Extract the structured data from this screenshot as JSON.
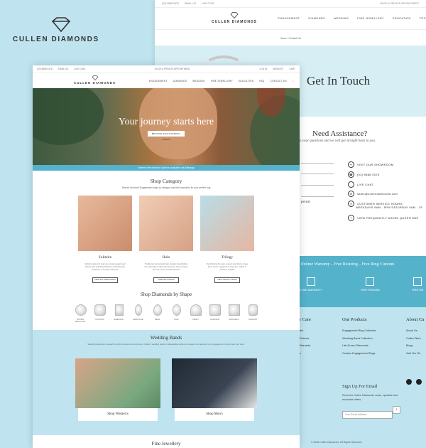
{
  "brand": {
    "name": "CULLEN DIAMONDS"
  },
  "contact_page": {
    "topbar": {
      "phone": "(03) 9888 5378",
      "email": "EMAIL US",
      "chat": "LIVE CHAT",
      "right": "BOOK A PRIVATE APPOINTMENT"
    },
    "nav": [
      "ENGAGEMENT",
      "DIAMONDS",
      "WEDDING",
      "FINE JEWELLERY",
      "EDUCATION",
      "TOO"
    ],
    "breadcrumb": "Home / Contact Us",
    "title": "Get In Touch",
    "assist_title": "Need Assistance?",
    "assist_sub": "n your questions and we will get straight back to you.",
    "special": "pecial",
    "contact_items": [
      {
        "icon": "location-pin-icon",
        "text": "VISIT OUR SHOWROOM"
      },
      {
        "icon": "phone-icon",
        "text": "(03) 9888 5378"
      },
      {
        "icon": "chat-icon",
        "text": "LIVE CHAT"
      },
      {
        "icon": "mail-icon",
        "text": "sales@cullendiamonds.com"
      },
      {
        "icon": "clock-icon",
        "text": "CUSTOMER SERVICE HOURS:"
      },
      {
        "icon": "",
        "text": "WEEKDAYS 9AM - 5PM SATURDAY 9AM - 1P"
      },
      {
        "icon": "question-icon",
        "text": "VIEW FREQUENTLY ASKED QUESTIONS"
      }
    ],
    "warranty_text": "ifetime Warranty – Free Resizing – Free Ring Customi",
    "warranty_items": [
      "ETIME WARRANTY",
      "FREE RESIZING",
      "FREE RIN"
    ],
    "footer": {
      "col_left_title": "r Care",
      "col_left_links": [
        "der",
        "",
        "",
        "Returns",
        "",
        "",
        "Warranty",
        "s"
      ],
      "products_title": "Our Products",
      "products_links": [
        "Engagement Ring Collection",
        "Wedding Band Collection",
        "Lab Grown Diamonds",
        "Custom Engagement Rings"
      ],
      "about_title": "About Cu",
      "about_links": [
        "About Us",
        "Cullen Diam",
        "Blogs",
        "Visit Our Sh"
      ],
      "signup_title": "Sign Up For Email",
      "signup_text": "Send me Cullen Diamonds news, updates and exclusive offers.",
      "email_placeholder": "Your Email Address",
      "copyright": "© 2023 Cullen Diamonds. All Rights Reserved."
    }
  },
  "home_page": {
    "topbar": {
      "phone": "(03) 9888 5378",
      "email": "EMAIL US",
      "chat": "LIVE CHAT",
      "mid": "BOOK A PRIVATE APPOINTMENT",
      "login": "LOG IN",
      "wishlist": "WISHLIST",
      "cart": "CART"
    },
    "nav": [
      "ENGAGEMENT",
      "DIAMONDS",
      "WEDDING",
      "FINE JEWELLERY",
      "EDUCATION",
      "FAQ",
      "CONTACT US"
    ],
    "hero_title": "Your journey starts here",
    "hero_button": "BROWSE ENGAGEMENT RINGS",
    "promo": "Interest free finance options available via Afterpay",
    "shop_category_title": "Shop Category",
    "shop_category_sub": "Browse Diamond Engagement rings by category and find inspiration for your perfect ring",
    "categories": [
      {
        "name": "Solitaire",
        "desc": "Solitaire diamond rings are simply elegant and classic with sparkling brilliance enhancing the brilliance of a Cullen diamond",
        "button": "VIEW SOLITAIRE RINGS"
      },
      {
        "name": "Halo",
        "desc": "Traditional and original halo designs handcrafted are especially sought after because they enhance the look of the central diamond",
        "button": "VIEW HALO RINGS"
      },
      {
        "name": "Trilogy",
        "desc": "Symbolising the past, present and future, these three stone engagement rings are crafted in timeless designs",
        "button": "VIEW TRILOGY RINGS"
      }
    ],
    "shapes_title": "Shop Diamonds by Shape",
    "shapes": [
      "ROUND BRILLIANT",
      "CUSHION",
      "EMERALD",
      "MARQUISE",
      "PEAR",
      "OVAL",
      "HEART",
      "ASSCHER",
      "PRINCESS",
      "RADIANT"
    ],
    "wedding_title": "Wedding Bands",
    "wedding_sub": "Wedding bands are a powerful symbol of love and commitment. Cullen's wedding bands in all available styles and metals to complement your engagement ring and suit your style.",
    "wedding_cards": [
      "Shop Women's",
      "Shop Men's"
    ],
    "fine_title": "Fine Jewellery"
  }
}
